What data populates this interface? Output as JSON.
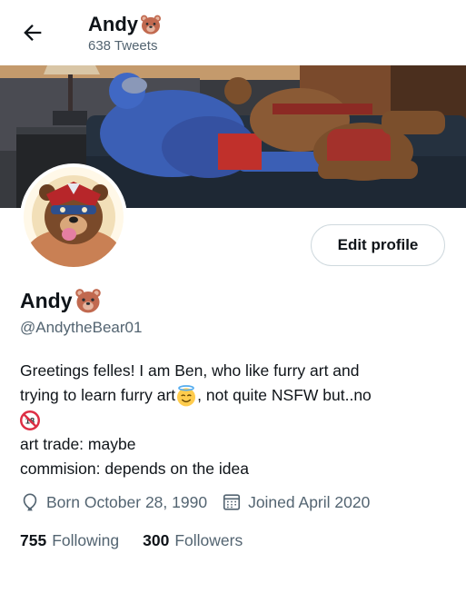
{
  "header": {
    "name": "Andy",
    "tweet_count": "638 Tweets"
  },
  "profile": {
    "display_name": "Andy",
    "handle": "@AndytheBear01",
    "edit_button": "Edit profile",
    "bio": {
      "line1": "Greetings felles! I am Ben, who like furry art and",
      "line2a": "trying to learn furry art",
      "line2b": ",  not quite NSFW but..no",
      "line4": "art trade: maybe",
      "line5": "commision: depends on the idea"
    },
    "birth": "Born October 28, 1990",
    "joined": "Joined April 2020",
    "following_count": "755",
    "following_label": "Following",
    "followers_count": "300",
    "followers_label": "Followers"
  },
  "icons": [
    "back-arrow-icon",
    "bear-emoji-icon",
    "halo-smile-emoji-icon",
    "no-under-18-emoji-icon",
    "balloon-icon",
    "calendar-icon"
  ],
  "colors": {
    "text": "#0f1419",
    "secondary": "#536471",
    "border": "#cfd9de"
  }
}
